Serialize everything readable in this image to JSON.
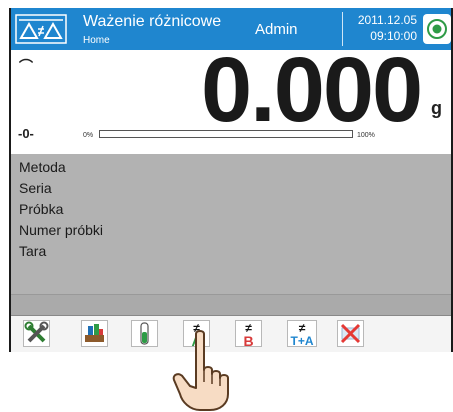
{
  "header": {
    "title": "Ważenie różnicowe",
    "breadcrumb": "Home",
    "user": "Admin",
    "date": "2011.12.05",
    "time": "09:10:00",
    "mode_icon": "differential-weighing-icon",
    "status_icon": "status-led-icon",
    "color": "#1f86cf"
  },
  "reading": {
    "stability_mark": "⌒",
    "zero_mark": "-0-",
    "value": "0.000",
    "unit": "g",
    "progress_min": "0%",
    "progress_max": "100%",
    "progress_fraction": 0
  },
  "info": {
    "rows": [
      "Metoda",
      "Seria",
      "Próbka",
      "Numer próbki",
      "Tara"
    ],
    "background": "#b2b2b2"
  },
  "buttons": [
    {
      "icon": "settings-tools-icon"
    },
    {
      "icon": "products-icon"
    },
    {
      "icon": "test-tube-icon"
    },
    {
      "icon": "weighing-a-icon",
      "symbol": "≠",
      "letter": "A",
      "color": "#2e9b46"
    },
    {
      "icon": "weighing-b-icon",
      "symbol": "≠",
      "letter": "B",
      "color": "#d83a3a"
    },
    {
      "icon": "weighing-t-a-icon",
      "symbol": "≠",
      "letter": "T+A",
      "color": "#1f86cf"
    },
    {
      "icon": "delete-series-icon"
    }
  ]
}
